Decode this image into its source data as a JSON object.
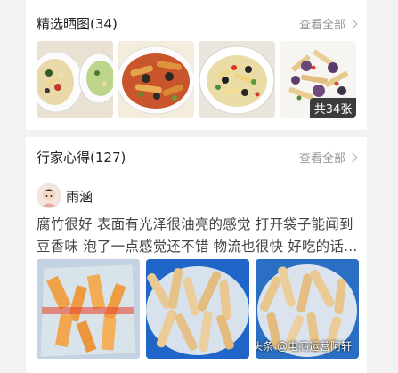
{
  "photos_section": {
    "title": "精选晒图(34)",
    "see_all": "查看全部",
    "count_badge": "共34张"
  },
  "reviews_section": {
    "title": "行家心得(127)",
    "see_all": "查看全部",
    "review": {
      "username": "雨涵",
      "text_line1": "腐竹很好 表面有光泽很油亮的感觉 打开袋子能闻到",
      "text_line2": "豆香味 泡了一点感觉还不错 物流也很快 好吃的话..."
    }
  },
  "watermark": "头条 @电商运营阿轩"
}
